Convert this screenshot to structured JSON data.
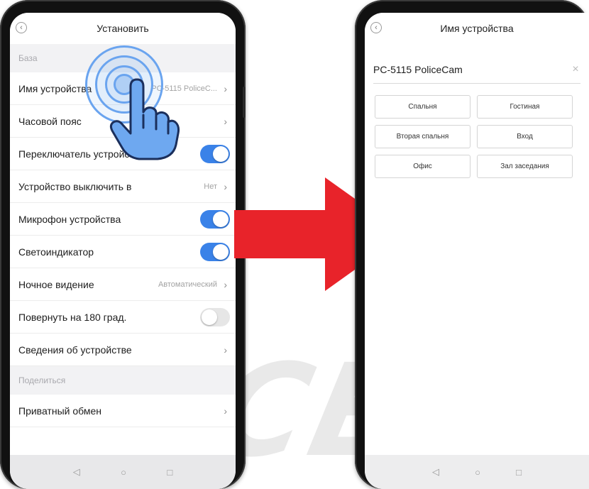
{
  "watermark": {
    "text": "ICE CAM"
  },
  "left_screen": {
    "title": "Установить",
    "back_icon": "chevron-left-icon",
    "sections": [
      {
        "header": "База",
        "rows": [
          {
            "label": "Имя устройства",
            "value": "PC-5115 PoliceC...",
            "control": "chevron"
          },
          {
            "label": "Часовой пояс",
            "value": "",
            "control": "chevron"
          },
          {
            "label": "Переключатель устройства",
            "value": "",
            "control": "toggle",
            "on": true
          },
          {
            "label": "Устройство выключить в",
            "value": "Нет",
            "control": "chevron"
          },
          {
            "label": "Микрофон устройства",
            "value": "",
            "control": "toggle",
            "on": true
          },
          {
            "label": "Светоиндикатор",
            "value": "",
            "control": "toggle",
            "on": true
          },
          {
            "label": "Ночное видение",
            "value": "Автоматический",
            "control": "chevron"
          },
          {
            "label": "Повернуть на 180 град.",
            "value": "",
            "control": "toggle",
            "on": false
          },
          {
            "label": "Сведения об устройстве",
            "value": "",
            "control": "chevron"
          }
        ]
      },
      {
        "header": "Поделиться",
        "rows": [
          {
            "label": "Приватный обмен",
            "value": "",
            "control": "chevron"
          }
        ]
      }
    ],
    "nav": {
      "back": "◁",
      "home": "○",
      "recent": "□"
    }
  },
  "right_screen": {
    "title": "Имя устройства",
    "back_icon": "chevron-left-icon",
    "name_value": "PC-5115 PoliceCam",
    "clear_icon": "×",
    "presets": [
      "Спальня",
      "Гостиная",
      "Вторая спальня",
      "Вход",
      "Офис",
      "Зал заседания"
    ],
    "nav": {
      "back": "◁",
      "home": "○",
      "recent": "□"
    }
  },
  "colors": {
    "accent": "#3a82e8",
    "arrow": "#e8232a",
    "touch": "#6aa4ef"
  }
}
